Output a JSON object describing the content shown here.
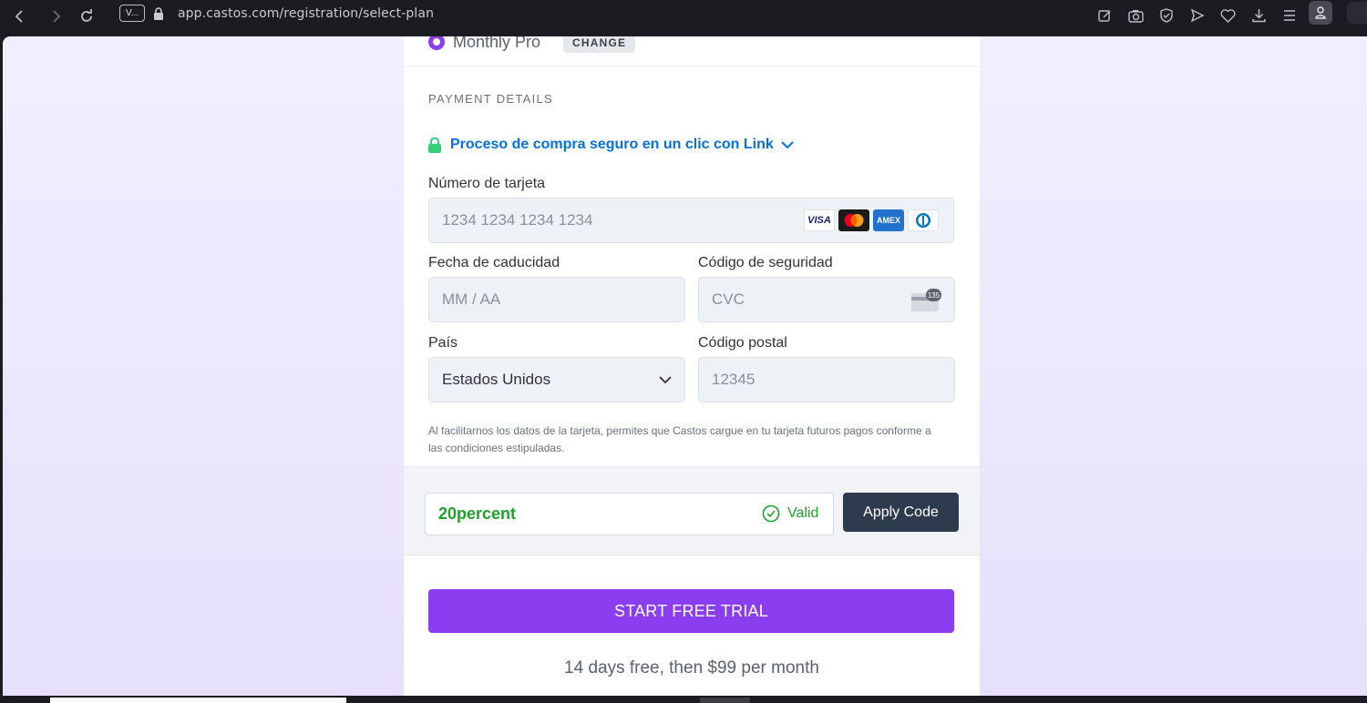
{
  "browser": {
    "tab_chip": "V...",
    "url": "app.castos.com/registration/select-plan"
  },
  "plan": {
    "name": "Monthly Pro",
    "change_label": "CHANGE"
  },
  "payment": {
    "section_title": "PAYMENT DETAILS",
    "link_text": "Proceso de compra seguro en un clic con Link",
    "card_number_label": "Número de tarjeta",
    "card_number_placeholder": "1234 1234 1234 1234",
    "card_brands": [
      "VISA",
      "Mastercard",
      "AMEX",
      "Diners"
    ],
    "expiry_label": "Fecha de caducidad",
    "expiry_placeholder": "MM / AA",
    "cvc_label": "Código de seguridad",
    "cvc_placeholder": "CVC",
    "cvc_badge": "135",
    "country_label": "País",
    "country_value": "Estados Unidos",
    "postal_label": "Código postal",
    "postal_placeholder": "12345",
    "terms": "Al facilitarnos los datos de la tarjeta, permites que Castos cargue en tu tarjeta futuros pagos conforme a las condiciones estipuladas."
  },
  "coupon": {
    "code": "20percent",
    "status": "Valid",
    "apply_label": "Apply Code"
  },
  "cta": {
    "label": "START FREE TRIAL",
    "note": "14 days free, then $99 per month"
  },
  "colors": {
    "accent": "#8b3df0",
    "link": "#0570de",
    "valid": "#1fa12f",
    "apply_button": "#2e3a4d"
  }
}
